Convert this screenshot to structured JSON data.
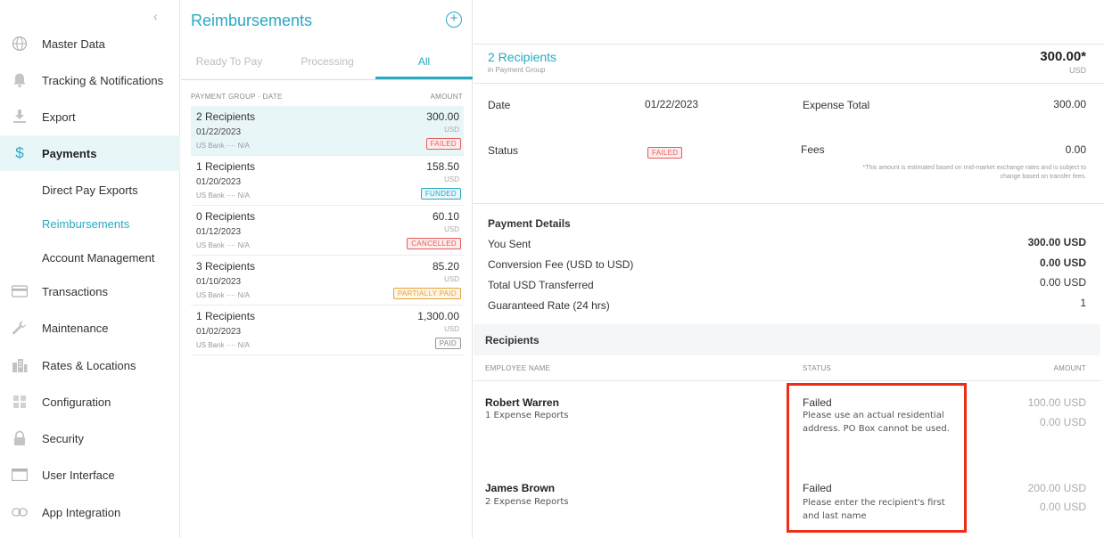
{
  "sidebar": {
    "collapse_icon": "chevron-left-icon",
    "items": [
      {
        "label": "Master Data",
        "icon": "globe-icon"
      },
      {
        "label": "Tracking & Notifications",
        "icon": "bell-icon"
      },
      {
        "label": "Export",
        "icon": "download-icon"
      },
      {
        "label": "Payments",
        "icon": "dollar-icon",
        "active": true
      },
      {
        "label": "Transactions",
        "icon": "card-icon"
      },
      {
        "label": "Maintenance",
        "icon": "wrench-icon"
      },
      {
        "label": "Rates & Locations",
        "icon": "building-icon"
      },
      {
        "label": "Configuration",
        "icon": "grid-icon"
      },
      {
        "label": "Security",
        "icon": "lock-icon"
      },
      {
        "label": "User Interface",
        "icon": "window-icon"
      },
      {
        "label": "App Integration",
        "icon": "link-icon"
      }
    ],
    "sub_items": [
      "Direct Pay Exports",
      "Reimbursements",
      "Account Management"
    ],
    "current_sub": "Reimbursements"
  },
  "list": {
    "title": "Reimbursements",
    "add_icon": "plus-circle-icon",
    "tabs": [
      "Ready To Pay",
      "Processing",
      "All"
    ],
    "active_tab": "All",
    "col_group": "PAYMENT GROUP · DATE",
    "col_amount": "AMOUNT",
    "rows": [
      {
        "title": "2 Recipients",
        "amount": "300.00",
        "date": "01/22/2023",
        "currency": "USD",
        "bank": "US Bank  ···· N/A",
        "status": "FAILED"
      },
      {
        "title": "1 Recipients",
        "amount": "158.50",
        "date": "01/20/2023",
        "currency": "USD",
        "bank": "US Bank  ···· N/A",
        "status": "FUNDED"
      },
      {
        "title": "0 Recipients",
        "amount": "60.10",
        "date": "01/12/2023",
        "currency": "USD",
        "bank": "US Bank  ···· N/A",
        "status": "CANCELLED"
      },
      {
        "title": "3 Recipients",
        "amount": "85.20",
        "date": "01/10/2023",
        "currency": "USD",
        "bank": "US Bank  ···· N/A",
        "status": "PARTIALLY PAID"
      },
      {
        "title": "1 Recipients",
        "amount": "1,300.00",
        "date": "01/02/2023",
        "currency": "USD",
        "bank": "US Bank  ···· N/A",
        "status": "PAID"
      }
    ]
  },
  "detail": {
    "heading": "2 Recipients",
    "subheading": "in Payment Group",
    "total": "300.00*",
    "total_currency": "USD",
    "date_label": "Date",
    "date_value": "01/22/2023",
    "expense_total_label": "Expense Total",
    "expense_total_value": "300.00",
    "status_label": "Status",
    "status_value": "FAILED",
    "fees_label": "Fees",
    "fees_value": "0.00",
    "fees_note": "*This amount is estimated based on mid-market exchange rates and is subject to change based on transfer fees.",
    "payment_details": {
      "title": "Payment Details",
      "rows": [
        {
          "label": "You Sent",
          "value": "300.00 USD"
        },
        {
          "label": "Conversion Fee (USD to USD)",
          "value": "0.00 USD"
        },
        {
          "label": "Total USD Transferred",
          "value": "0.00 USD"
        },
        {
          "label": "Guaranteed Rate (24 hrs)",
          "value": "1"
        }
      ]
    },
    "recipients": {
      "title": "Recipients",
      "col_name": "EMPLOYEE NAME",
      "col_status": "STATUS",
      "col_amount": "AMOUNT",
      "items": [
        {
          "name": "Robert Warren",
          "reports": "1 Expense Reports",
          "status": "Failed",
          "message": "Please use an actual residential address. PO Box cannot be used.",
          "amount": "100.00 USD",
          "amount2": "0.00 USD"
        },
        {
          "name": "James Brown",
          "reports": "2 Expense Reports",
          "status": "Failed",
          "message": "Please enter the recipient's first and last name",
          "amount": "200.00 USD",
          "amount2": "0.00 USD"
        }
      ]
    }
  },
  "colors": {
    "accent": "#28a9c2",
    "failed": "#e45d5d",
    "highlight": "#ee2d19"
  }
}
